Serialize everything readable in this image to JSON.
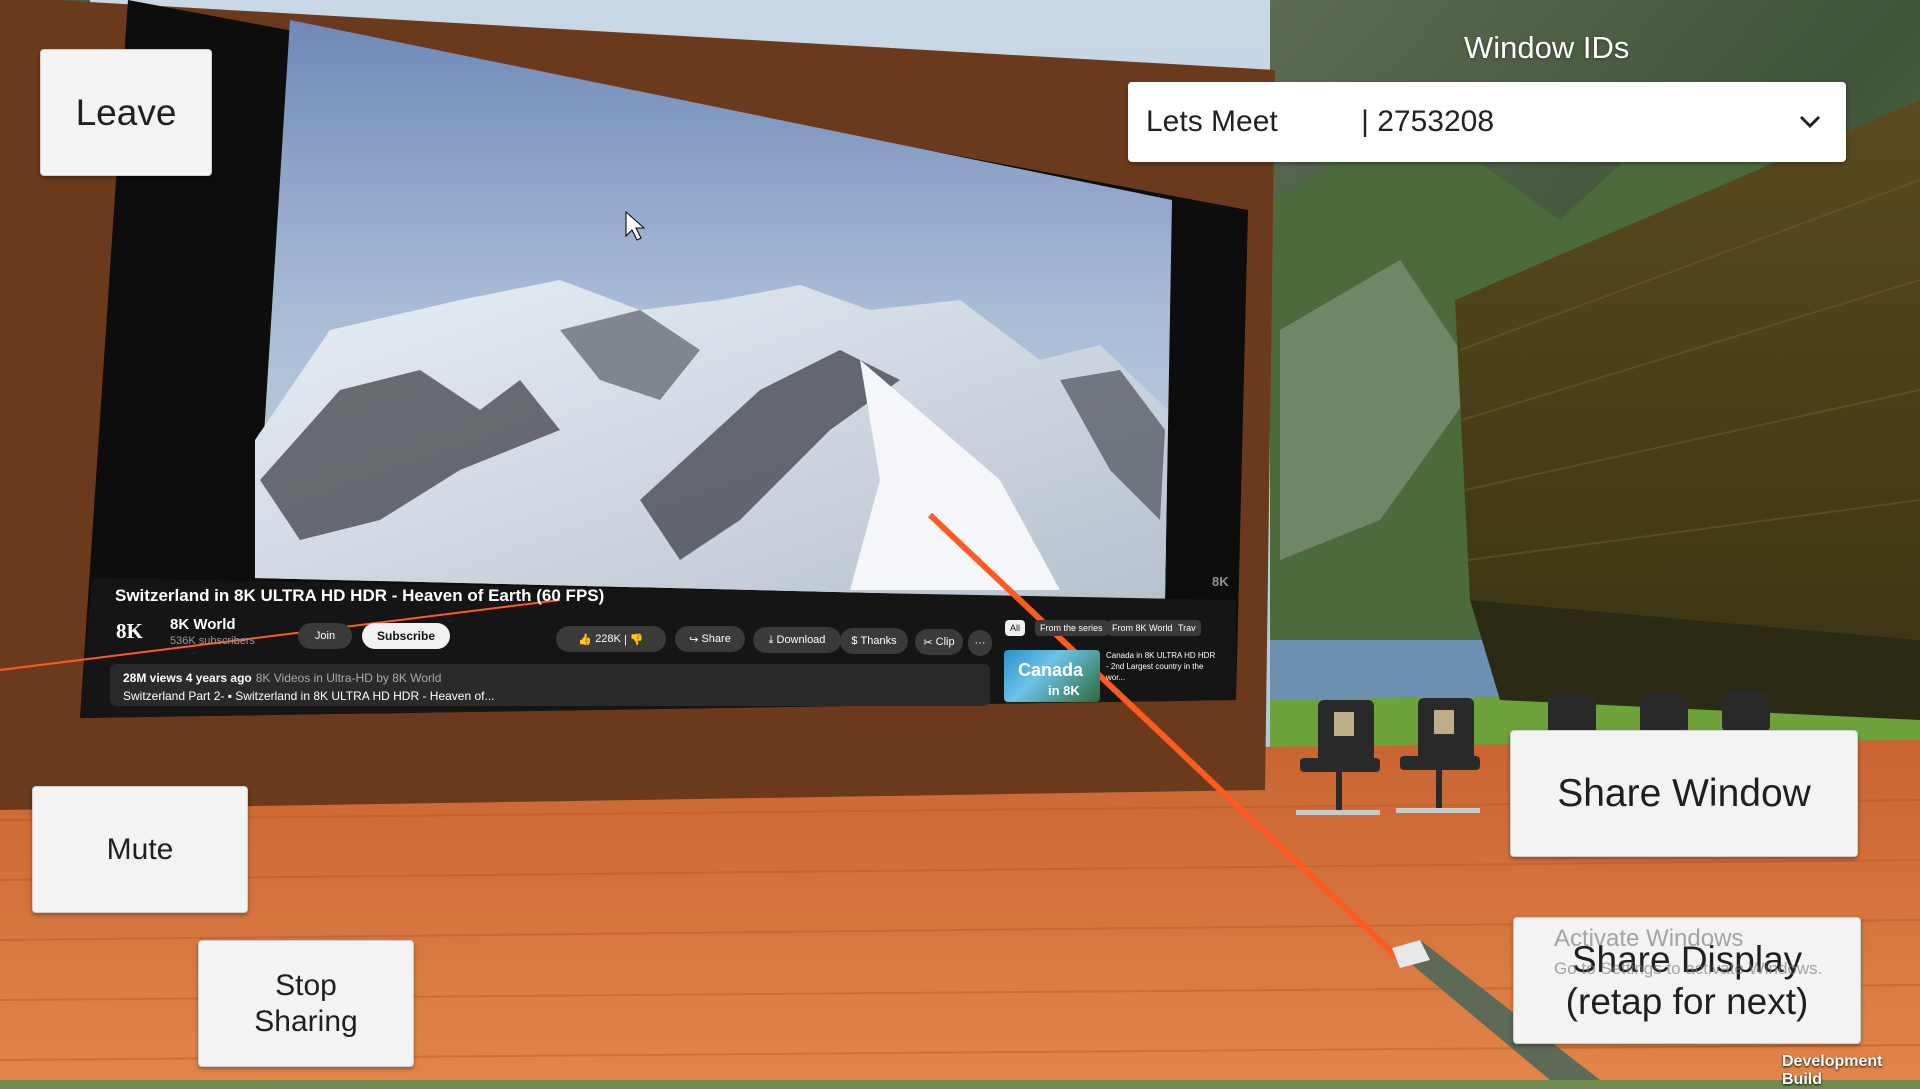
{
  "buttons": {
    "leave": "Leave",
    "mute": "Mute",
    "stop_line1": "Stop",
    "stop_line2": "Sharing",
    "share_window": "Share Window",
    "share_display_line1": "Share Display",
    "share_display_line2": "(retap for next)"
  },
  "window_ids": {
    "title": "Window IDs",
    "selected": "Lets Meet          | 2753208"
  },
  "video": {
    "title": "Switzerland in 8K ULTRA HD HDR - Heaven of Earth (60 FPS)",
    "channel_logo": "8K",
    "channel_name": "8K World",
    "subscribers": "536K subscribers",
    "join": "Join",
    "subscribe": "Subscribe",
    "likes": "228K",
    "share": "Share",
    "download": "Download",
    "thanks": "Thanks",
    "clip": "Clip",
    "more": "···",
    "views": "28M views  4 years ago",
    "views_extra": "8K Videos in Ultra-HD by 8K World",
    "series": "Switzerland Part 2-  ▪ Switzerland in 8K ULTRA HD HDR - Heaven of...",
    "chips": [
      "All",
      "From the series",
      "From 8K World",
      "Trav"
    ],
    "rec_thumb_title": "Canada",
    "rec_thumb_sub": "in 8K",
    "rec_title": "Canada in 8K ULTRA HD HDR - 2nd Largest country in the wor...",
    "watermark": "8K"
  },
  "system": {
    "activate_title": "Activate Windows",
    "activate_sub": "Go to Settings to activate Windows.",
    "dev_build": "Development Build"
  },
  "colors": {
    "frame": "#6b3a1c",
    "floor": "#d2703a",
    "laser": "#ff5a1f",
    "button_bg": "#f3f3f3"
  }
}
